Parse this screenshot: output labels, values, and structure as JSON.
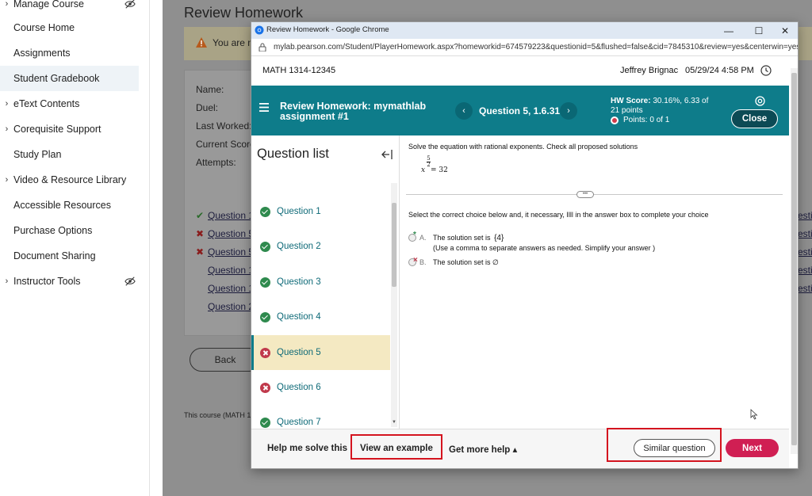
{
  "sidebar": {
    "items": [
      {
        "label": "Manage Course",
        "arrow": true,
        "hidden_icon": true
      },
      {
        "label": "Course Home"
      },
      {
        "label": "Assignments"
      },
      {
        "label": "Student Gradebook",
        "active": true
      },
      {
        "label": "eText Contents",
        "arrow": true
      },
      {
        "label": "Corequisite Support",
        "arrow": true
      },
      {
        "label": "Study Plan"
      },
      {
        "label": "Video & Resource Library",
        "arrow": true
      },
      {
        "label": "Accessible Resources"
      },
      {
        "label": "Purchase Options"
      },
      {
        "label": "Document Sharing"
      },
      {
        "label": "Instructor Tools",
        "arrow": true,
        "hidden_icon": true
      }
    ]
  },
  "background": {
    "page_title": "Review Homework",
    "banner_text": "You are n",
    "labels": [
      "Name:",
      "Duel:",
      "Last Worked:",
      "Current Score",
      "Attempts:"
    ],
    "links": [
      "Question 1",
      "Question 5",
      "Question 5",
      "Question 1",
      "Question 1",
      "Question 2"
    ],
    "back_label": "Back",
    "footer_text": "This course (MATH 1",
    "right_links": [
      "esti",
      "esti",
      "esti",
      "esti",
      "esti"
    ]
  },
  "window": {
    "title": "Review Homework - Google Chrome",
    "url": "mylab.pearson.com/Student/PlayerHomework.aspx?homeworkid=674579223&questionid=5&flushed=false&cid=7845310&review=yes&centerwin=yes",
    "course_code": "MATH 1314-12345",
    "user": "Jeffrey Brignac",
    "datetime": "05/29/24 4:58 PM",
    "header": {
      "title": "Review Homework: mymathlab assignment #1",
      "question": "Question 5, 1.6.31",
      "hw_score_label": "HW Score:",
      "hw_score_value": "30.16%, 6.33 of",
      "hw_points": "21 points",
      "points": "Points: 0 of 1",
      "close_label": "Close"
    },
    "question_list": {
      "title": "Question list",
      "items": [
        {
          "label": "Question 1",
          "status": "correct"
        },
        {
          "label": "Question 2",
          "status": "correct"
        },
        {
          "label": "Question 3",
          "status": "correct"
        },
        {
          "label": "Question 4",
          "status": "correct"
        },
        {
          "label": "Question 5",
          "status": "incorrect",
          "active": true
        },
        {
          "label": "Question 6",
          "status": "incorrect"
        },
        {
          "label": "Question 7",
          "status": "correct"
        }
      ]
    },
    "question": {
      "prompt": "Solve the equation with rational exponents. Check all proposed solutions",
      "eq_num": "5",
      "eq_den": "2",
      "eq_base": "x",
      "eq_rest": "= 32",
      "instruction": "Select the correct choice below and, it necessary, Illl in the answer box to complete your choice",
      "choice_a_letter": "A.",
      "choice_a_text": "The solution set is",
      "choice_a_answer": "{4}",
      "choice_a_hint": "(Use a comma to separate answers as needed. Simplify your answer )",
      "choice_b_letter": "B.",
      "choice_b_text": "The solution set is ∅"
    },
    "footer": {
      "help_me": "Help me solve this",
      "example": "View an example",
      "more_help": "Get more help ▴",
      "similar": "Similar question",
      "next": "Next"
    }
  },
  "colors": {
    "header_teal": "#0e7c8a",
    "correct_green": "#2f8a4e",
    "incorrect_red": "#c0394b",
    "next_pink": "#d01f53",
    "highlight_red": "#d4141f"
  }
}
